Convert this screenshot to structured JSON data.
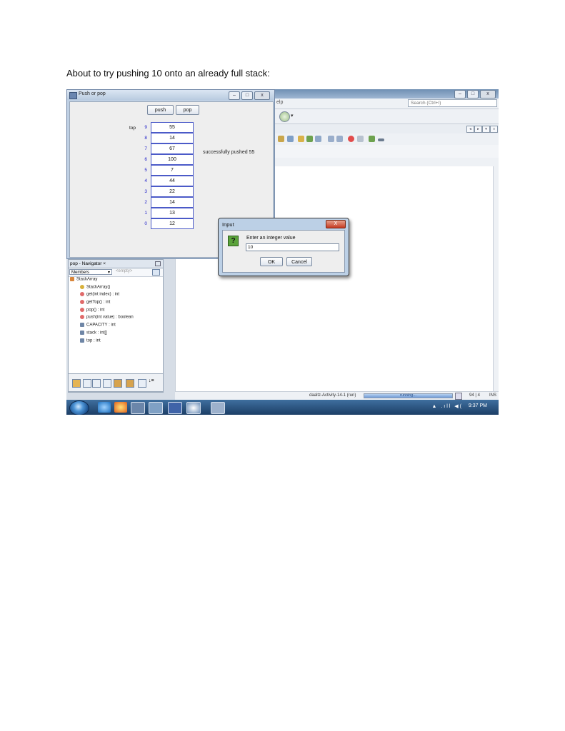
{
  "caption": "About to try pushing 10 onto an already full stack:",
  "netbeans": {
    "menu_fragment": "elp",
    "search_placeholder": "Search (Ctrl+I)",
    "status": {
      "project": "daaltz-Activity-14-1 (run)",
      "progress_text": "running...",
      "position": "94 | 4",
      "mode": "INS"
    }
  },
  "push_pop_window": {
    "title": "Push or pop",
    "push_label": "push",
    "pop_label": "pop",
    "top_label": "top",
    "message": "successfully pushed 55",
    "stack": [
      {
        "index": "9",
        "value": "55"
      },
      {
        "index": "8",
        "value": "14"
      },
      {
        "index": "7",
        "value": "67"
      },
      {
        "index": "6",
        "value": "100"
      },
      {
        "index": "5",
        "value": "7"
      },
      {
        "index": "4",
        "value": "44"
      },
      {
        "index": "3",
        "value": "22"
      },
      {
        "index": "2",
        "value": "14"
      },
      {
        "index": "1",
        "value": "13"
      },
      {
        "index": "0",
        "value": "12"
      }
    ]
  },
  "input_dialog": {
    "title": "Input",
    "close_glyph": "X",
    "question_glyph": "?",
    "prompt": "Enter an integer value",
    "value": "10",
    "ok_label": "OK",
    "cancel_label": "Cancel"
  },
  "navigator": {
    "title": "pop - Navigator",
    "close_glyph": "×",
    "filter_selected": "Members",
    "filter_empty": "<empty>",
    "items": [
      {
        "label": "StackArray",
        "icon": "class-icon"
      },
      {
        "label": "StackArray()",
        "icon": "constructor-icon"
      },
      {
        "label": "get(int index) : int",
        "icon": "method-icon"
      },
      {
        "label": "getTop() : int",
        "icon": "method-icon"
      },
      {
        "label": "pop() : int",
        "icon": "method-icon"
      },
      {
        "label": "push(int value) : boolean",
        "icon": "method-icon"
      },
      {
        "label": "CAPACITY : int",
        "icon": "field-icon"
      },
      {
        "label": "stack : int[]",
        "icon": "field-icon"
      },
      {
        "label": "top : int",
        "icon": "field-icon"
      }
    ]
  },
  "taskbar": {
    "time": "9:37 PM",
    "tray": "▲ .ıll ◀("
  }
}
